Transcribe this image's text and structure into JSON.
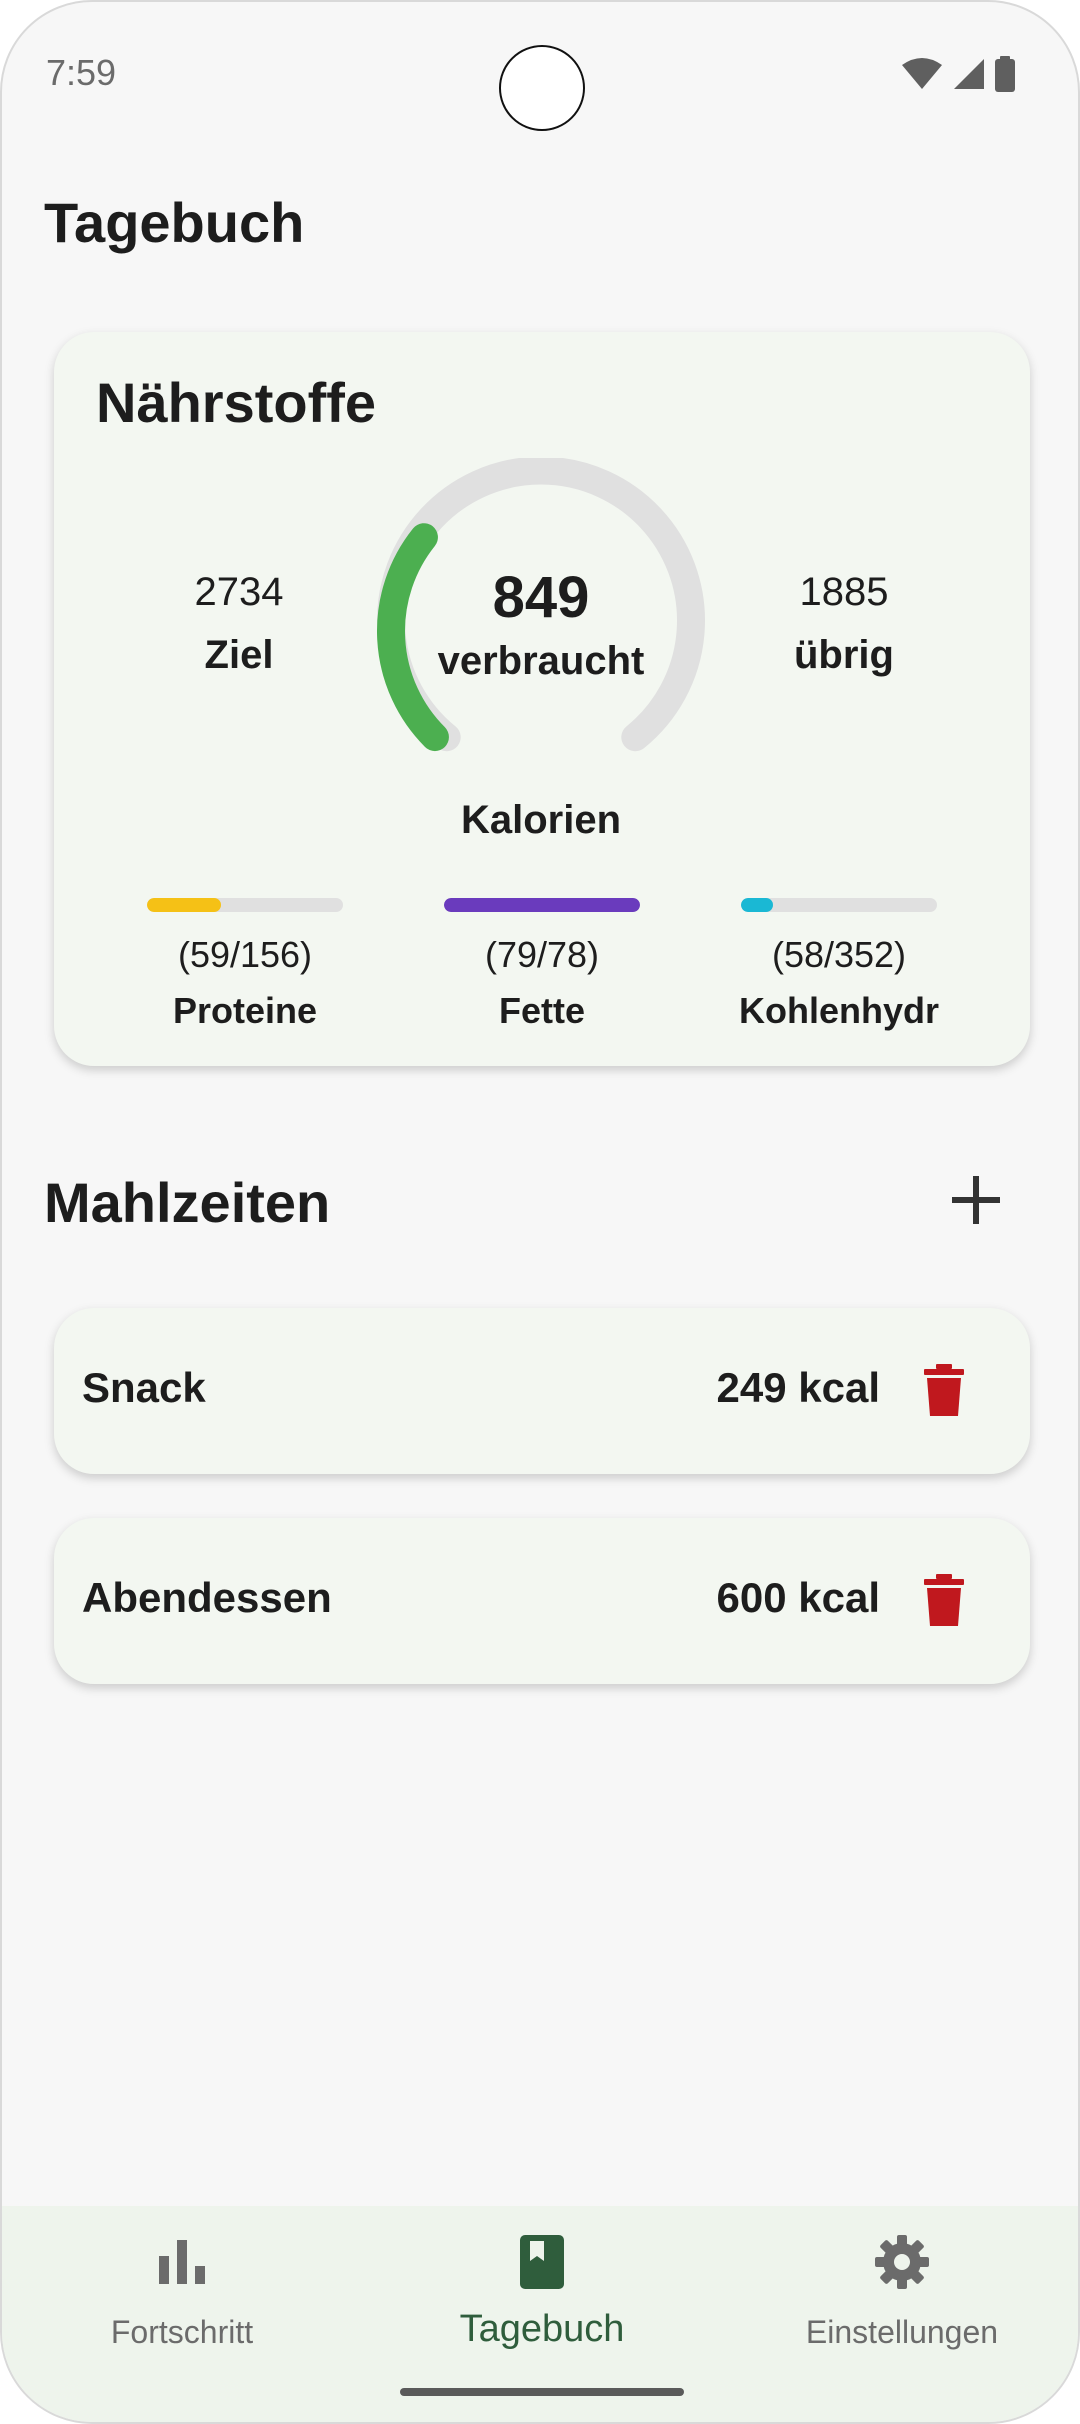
{
  "status_bar": {
    "time": "7:59"
  },
  "page_title": "Tagebuch",
  "nutrients": {
    "title": "Nährstoffe",
    "goal": {
      "value": "2734",
      "label": "Ziel"
    },
    "consumed": {
      "value": "849",
      "label": "verbraucht"
    },
    "remaining": {
      "value": "1885",
      "label": "übrig"
    },
    "calories_label": "Kalorien",
    "calorie_progress": 0.31,
    "macros": [
      {
        "value": "(59/156)",
        "name": "Proteine",
        "progress": 0.378,
        "color": "#f5c116"
      },
      {
        "value": "(79/78)",
        "name": "Fette",
        "progress": 1.0,
        "color": "#6a3bbd"
      },
      {
        "value": "(58/352)",
        "name": "Kohlenhydr",
        "progress": 0.165,
        "color": "#1ab8d4"
      }
    ]
  },
  "meals": {
    "title": "Mahlzeiten",
    "add_icon": "plus-icon",
    "items": [
      {
        "name": "Snack",
        "kcal": "249 kcal",
        "icon": "trash-icon"
      },
      {
        "name": "Abendessen",
        "kcal": "600 kcal",
        "icon": "trash-icon"
      }
    ]
  },
  "bottom_nav": {
    "items": [
      {
        "label": "Fortschritt",
        "icon": "bar-chart-icon",
        "active": false
      },
      {
        "label": "Tagebuch",
        "icon": "diary-icon",
        "active": true
      },
      {
        "label": "Einstellungen",
        "icon": "gear-icon",
        "active": false
      }
    ]
  },
  "colors": {
    "accent": "#2f5d3c",
    "gauge_progress": "#4caf50",
    "gauge_track": "#e0e0e0",
    "delete": "#c0181e"
  }
}
